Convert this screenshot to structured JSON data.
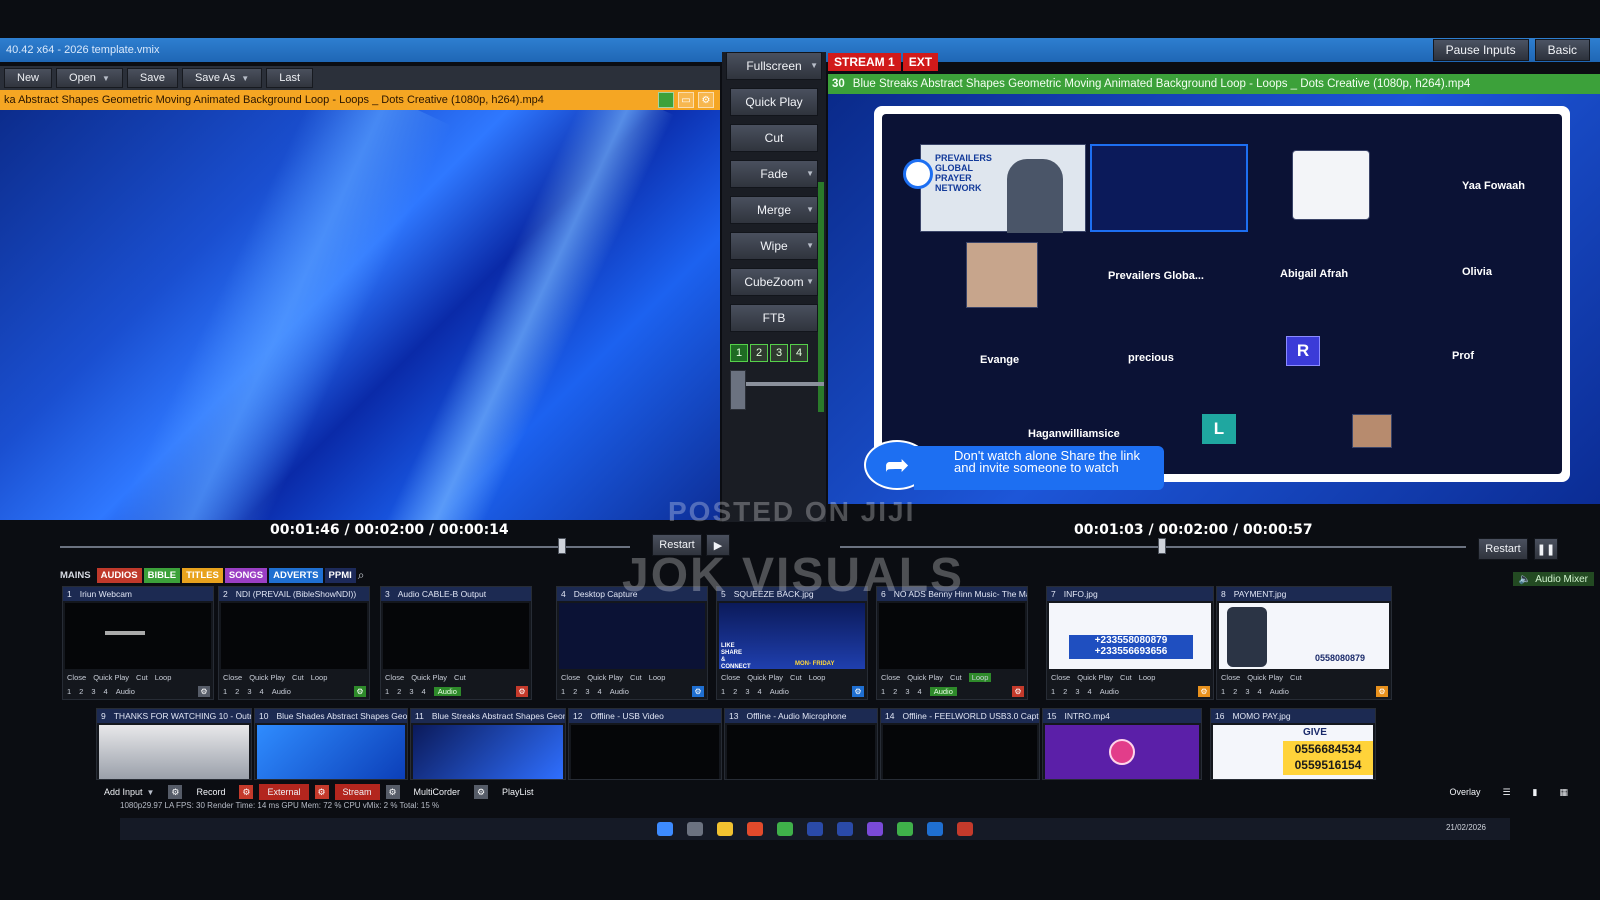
{
  "window": {
    "title": "40.42 x64 - 2026 template.vmix"
  },
  "titlebar_buttons": {
    "pause_inputs": "Pause Inputs",
    "basic": "Basic"
  },
  "menu": {
    "new": "New",
    "open": "Open",
    "save": "Save",
    "save_as": "Save As",
    "last": "Last"
  },
  "preview": {
    "title": "ka Abstract Shapes Geometric Moving Animated Background Loop - Loops _ Dots Creative (1080p, h264).mp4",
    "timecode": "00:01:46  /  00:02:00  /  00:00:14",
    "restart_label": "Restart"
  },
  "transitions": {
    "fullscreen": "Fullscreen",
    "quick_play": "Quick Play",
    "cut": "Cut",
    "fade": "Fade",
    "merge": "Merge",
    "wipe": "Wipe",
    "cubezoom": "CubeZoom",
    "ftb": "FTB",
    "numbers": [
      "1",
      "2",
      "3",
      "4"
    ]
  },
  "output": {
    "stream_label": "STREAM 1",
    "ext_label": "EXT",
    "number": "30",
    "title": "Blue Streaks Abstract Shapes Geometric Moving Animated Background Loop - Loops _ Dots Creative (1080p, h264).mp4",
    "timecode": "00:01:03  /  00:02:00  /  00:00:57",
    "restart_label": "Restart",
    "meeting": {
      "logo_text": "PREVAILERS GLOBAL PRAYER NETWORK",
      "participants": {
        "yaa": "Yaa Fowaah",
        "prevailers": "Prevailers Globa...",
        "abigail": "Abigail Afrah",
        "olivia": "Olivia",
        "evange": "Evange",
        "precious": "precious",
        "prof": "Prof",
        "haganwilliamsice": "Haganwilliamsice"
      },
      "avatar_r": "R",
      "avatar_l": "L",
      "share_text": "Don't watch alone Share the link and invite someone to watch"
    }
  },
  "tabs": [
    "MAINS",
    "AUDIOS",
    "BIBLE",
    "TITLES",
    "SONGS",
    "ADVERTS",
    "PPMI"
  ],
  "audio_mixer": "Audio Mixer",
  "inputs": [
    {
      "num": "1",
      "name": "Iriun Webcam"
    },
    {
      "num": "2",
      "name": "NDI (PREVAIL (BibleShowNDI))"
    },
    {
      "num": "3",
      "name": "Audio CABLE-B Output"
    },
    {
      "num": "4",
      "name": "Desktop Capture"
    },
    {
      "num": "5",
      "name": "SQUEEZE BACK.jpg"
    },
    {
      "num": "6",
      "name": "NO ADS Benny Hinn Music- The Mas"
    },
    {
      "num": "7",
      "name": "INFO.jpg"
    },
    {
      "num": "8",
      "name": "PAYMENT.jpg"
    },
    {
      "num": "9",
      "name": "THANKS FOR WATCHING 10 - Outr"
    },
    {
      "num": "10",
      "name": "Blue Shades Abstract Shapes Geome"
    },
    {
      "num": "11",
      "name": "Blue Streaks Abstract Shapes Geome"
    },
    {
      "num": "12",
      "name": "Offline - USB Video"
    },
    {
      "num": "13",
      "name": "Offline - Audio Microphone"
    },
    {
      "num": "14",
      "name": "Offline - FEELWORLD USB3.0 Captu"
    },
    {
      "num": "15",
      "name": "INTRO.mp4"
    },
    {
      "num": "16",
      "name": "MOMO PAY.jpg"
    }
  ],
  "input_controls": {
    "close": "Close",
    "quick_play": "Quick Play",
    "cut": "Cut",
    "loop": "Loop",
    "audio": "Audio"
  },
  "input_numbers": [
    "1",
    "2",
    "3",
    "4"
  ],
  "info_phones": [
    "+233558080879",
    "+233556693656"
  ],
  "payment_phone": "0558080879",
  "momo_label": "GIVE",
  "momo_phones": [
    "0556684534",
    "0559516154"
  ],
  "squeeze_text": {
    "like": "LIKE SHARE & CONNECT",
    "days": "MON- FRIDAY"
  },
  "intro_icon": "intro-logo",
  "bottom": {
    "add_input": "Add Input",
    "record": "Record",
    "external": "External",
    "stream": "Stream",
    "multicorder": "MultiCorder",
    "playlist": "PlayList",
    "overlay": "Overlay"
  },
  "status": "1080p29.97   LA  FPS: 30  Render Time: 14 ms  GPU Mem: 72 %  CPU vMix: 2 %  Total: 15 %",
  "clock": "21/02/2026",
  "watermarks": {
    "posted": "POSTED ON JIJI",
    "brand": "JOK VISUALS"
  }
}
